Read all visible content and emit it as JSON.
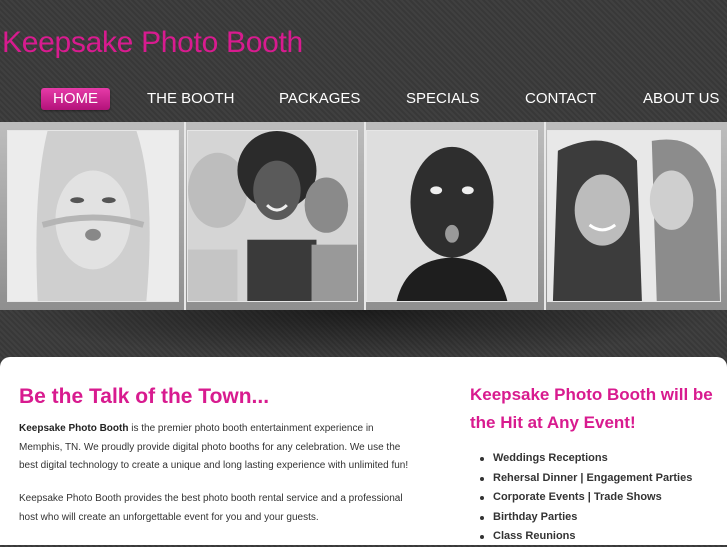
{
  "site": {
    "title": "Keepsake Photo Booth"
  },
  "nav": {
    "items": [
      {
        "label": "HOME",
        "active": true
      },
      {
        "label": "THE BOOTH"
      },
      {
        "label": "PACKAGES"
      },
      {
        "label": "SPECIALS"
      },
      {
        "label": "CONTACT"
      },
      {
        "label": "ABOUT US"
      }
    ]
  },
  "main": {
    "heading": "Be the Talk of the Town...",
    "intro_brand": "Keepsake Photo Booth",
    "intro_text": " is the premier photo booth entertainment experience in Memphis, TN. We proudly provide digital photo booths for any celebration. We use the best digital technology to create a unique and long lasting experience with unlimited fun!",
    "paragraph2": "Keepsake Photo Booth provides the best photo booth rental service and a professional host who will create an unforgettable event for you and your guests."
  },
  "side": {
    "heading": "Keepsake Photo Booth will be the Hit at Any Event!",
    "events": [
      "Weddings Receptions",
      "Rehersal Dinner | Engagement Parties",
      "Corporate Events | Trade Shows",
      "Birthday Parties",
      "Class Reunions"
    ]
  },
  "colors": {
    "accent": "#d81b8f",
    "background": "#3a3a3a",
    "content": "#ffffff"
  }
}
